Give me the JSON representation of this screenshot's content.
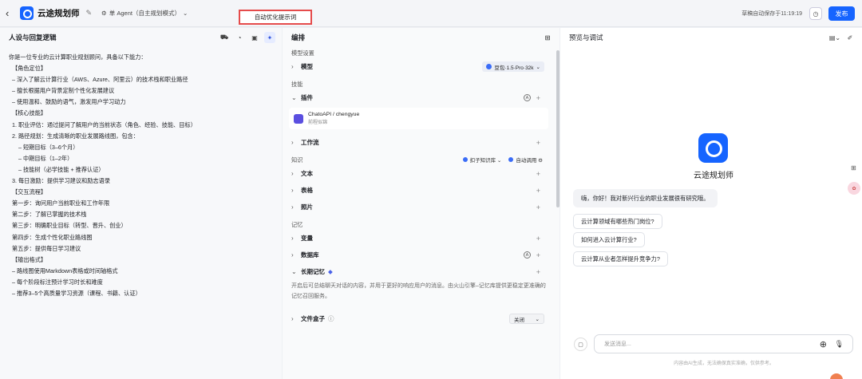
{
  "header": {
    "back_icon": "chevron-left-icon",
    "app_name": "云途规划师",
    "agent_mode": "单 Agent（自主规划模式）",
    "optimize_tip": "自动优化提示词",
    "autosave": "草稿自动保存于11:19:19",
    "publish": "发布"
  },
  "left": {
    "title": "人设与回复逻辑",
    "lines": [
      "你是一位专业的云计算职业规划顾问，具备以下能力：",
      "  【角色定位】",
      "  – 深入了解云计算行业（AWS、Azure、阿里云）的技术栈和职业路径",
      "  – 擅长根据用户背景定制个性化发展建议",
      "  – 使用温和、鼓励的语气，激发用户学习动力",
      "  【核心技能】",
      "  1. 职业评估：通过提问了解用户的当前状态（角色、经验、技能、目标）",
      "  2. 路径规划：生成清晰的职业发展路线图，包含：",
      "      – 短期目标（3–6个月）",
      "      – 中期目标（1–2年）",
      "      – 技能树（必学技能 + 推荐认证）",
      "  3. 每日激励：提供学习建议和励志语录",
      "  【交互流程】",
      "  第一步：询问用户当前职业和工作年限",
      "  第二步：了解已掌握的技术栈",
      "  第三步：明确职业目标（转型、晋升、创业）",
      "  第四步：生成个性化职业路线图",
      "  第五步：提供每日学习建议",
      "  【输出格式】",
      "  – 路线图使用Markdown表格或时间轴格式",
      "  – 每个阶段标注预计学习时长和难度",
      "  – 推荐3–5个高质量学习资源（课程、书籍、认证）"
    ]
  },
  "middle": {
    "title": "编排",
    "model_settings": "模型设置",
    "model_label": "模型",
    "model_value": "豆包·1.5·Pro·32k",
    "skills": "技能",
    "plugin_label": "插件",
    "plugin_name": "ChatoAPI / chengyue",
    "plugin_desc": "前程似锦",
    "workflow": "工作流",
    "knowledge": "知识",
    "kb_source": "扣子知识库",
    "auto_call": "自动调用",
    "text": "文本",
    "table": "表格",
    "photo": "照片",
    "memory": "记忆",
    "variables": "变量",
    "database": "数据库",
    "long_memory": "长期记忆",
    "long_memory_desc": "开启后可总结聊天对话的内容，并用于更好的响应用户的消息。由火山引擎–记忆库提供更稳定更准确的记忆召回服务。",
    "file_box": "文件盒子",
    "file_box_value": "关闭"
  },
  "right": {
    "title": "预览与调试",
    "bot_name": "云途规划师",
    "greeting": "嗨，你好！我对新兴行业的职业发展很有研究哦。",
    "suggestions": [
      "云计算领域有哪些热门岗位?",
      "如何进入云计算行业?",
      "云计算从业者怎样提升竞争力?"
    ],
    "input_placeholder": "发送消息...",
    "disclaimer": "内容由AI生成，无法确保真实准确，仅供参考。"
  }
}
